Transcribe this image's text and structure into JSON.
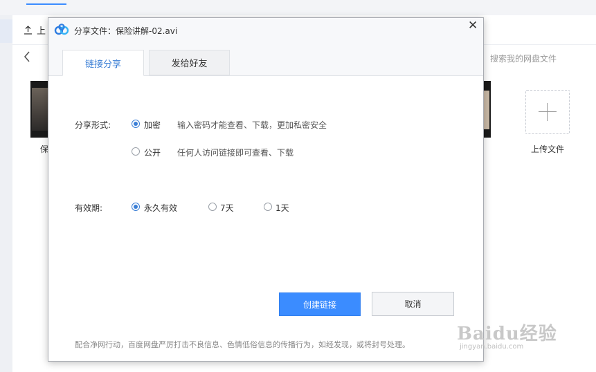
{
  "background": {
    "upload_label": "上",
    "search_placeholder": "搜索我的网盘文件",
    "thumb_left_label": "保",
    "upload_file_label": "上传文件"
  },
  "dialog": {
    "title": "分享文件：保险讲解-02.avi",
    "close_glyph": "✕",
    "tabs": [
      {
        "label": "链接分享",
        "active": true
      },
      {
        "label": "发给好友",
        "active": false
      }
    ],
    "share_form": {
      "label": "分享形式:",
      "options": [
        {
          "label": "加密",
          "desc": "输入密码才能查看、下载，更加私密安全",
          "checked": true
        },
        {
          "label": "公开",
          "desc": "任何人访问链接即可查看、下载",
          "checked": false
        }
      ]
    },
    "validity": {
      "label": "有效期:",
      "options": [
        {
          "label": "永久有效",
          "checked": true
        },
        {
          "label": "7天",
          "checked": false
        },
        {
          "label": "1天",
          "checked": false
        }
      ]
    },
    "create_button": "创建链接",
    "cancel_button": "取消",
    "footnote": "配合净网行动，百度网盘严厉打击不良信息、色情低俗信息的传播行为，如经发现，或将封号处理。"
  },
  "watermark": {
    "brand": "Baidu经验",
    "url": "jingyan.baidu.com"
  },
  "colors": {
    "accent": "#3b8cff",
    "tab_active_text": "#3b7fd6",
    "dialog_header_bg": "#f7f8fa"
  }
}
